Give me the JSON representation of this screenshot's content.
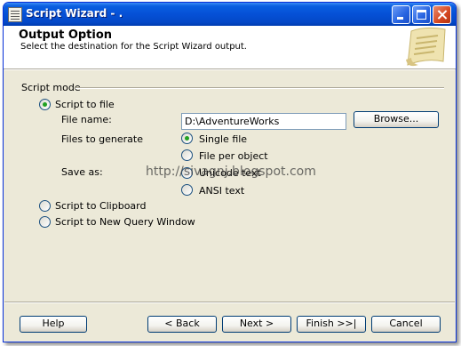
{
  "window": {
    "title": "Script Wizard - ."
  },
  "header": {
    "title": "Output Option",
    "subtitle": "Select the destination for the Script Wizard output."
  },
  "script_mode": {
    "group_label": "Script mode",
    "options": [
      {
        "label": "Script to file",
        "selected": true
      },
      {
        "label": "Script to Clipboard",
        "selected": false
      },
      {
        "label": "Script to New Query Window",
        "selected": false
      }
    ]
  },
  "file": {
    "name_label": "File name:",
    "name_value": "D:\\AdventureWorks",
    "browse_label": "Browse...",
    "files_to_generate_label": "Files to generate",
    "files_options": [
      {
        "label": "Single file",
        "selected": true
      },
      {
        "label": "File per object",
        "selected": false
      }
    ],
    "save_as_label": "Save as:",
    "save_as_options": [
      {
        "label": "Unicode text",
        "selected": false
      },
      {
        "label": "ANSI text",
        "selected": false
      }
    ]
  },
  "watermark": "http://sivagnj.blogspot.com",
  "buttons": {
    "help": "Help",
    "back": "< Back",
    "next": "Next >",
    "finish": "Finish >>|",
    "cancel": "Cancel"
  },
  "colors": {
    "titlebar": "#0550d6",
    "dialog_bg": "#ece9d8",
    "radio_dot": "#21a121"
  }
}
